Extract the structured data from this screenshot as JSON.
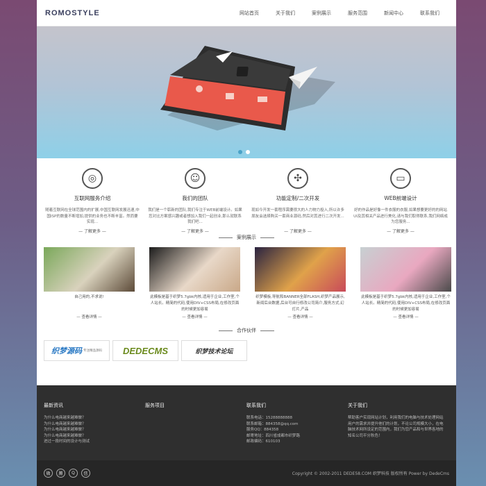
{
  "header": {
    "logo": "ROMOSTYLE",
    "nav": [
      "网站首页",
      "关于我们",
      "案例展示",
      "服务范围",
      "新闻中心",
      "联系我们"
    ]
  },
  "banner": {
    "dots": [
      {
        "active": true,
        "color": "#4aa3c8"
      },
      {
        "active": false,
        "color": "#ffffff"
      }
    ],
    "colors": {
      "screen": "#e9594b",
      "frame": "#2d2d2d"
    }
  },
  "services": [
    {
      "icon": "globe-icon",
      "glyph": "◎",
      "title": "互联网服务介绍",
      "desc": "随着互联网在全球范围内的扩展,中国互联网发展迅速,中国ISP的数量不断增加,提供的业务也不断丰富。然而要实现...",
      "more": "— 了解更多 —"
    },
    {
      "icon": "team-icon",
      "glyph": "☺",
      "title": "我们的团队",
      "desc": "我们是一个崭新的团队,我们专注于WEB前端设计。如果您对比方案感兴趣或者想加入我们一起创业,那么就联系我们吧...",
      "more": "— 了解更多 —"
    },
    {
      "icon": "custom-dev-icon",
      "glyph": "✣",
      "title": "功能定制/二次开发",
      "desc": "现如今开发一套程序需要很大的人力物力投入,所以许多朋友会选择购买一套商业源码,然后对其进行二次开发...",
      "more": "— 了解更多 —"
    },
    {
      "icon": "web-frontend-icon",
      "glyph": "▭",
      "title": "WEB前端设计",
      "desc": "好的作品是好像一件衣服的衣服,如果想要更好的的网站UI及其相关产品进行美化,请与我们取得联系,我们网络成为您服务...",
      "more": "— 了解更多 —"
    }
  ],
  "cases_heading": "案例展示",
  "cases": [
    {
      "desc": "自己用的,不求说!",
      "more": "— 查看详情 —",
      "colors": [
        "#7aa85a",
        "#d9d2bd",
        "#5c4a38"
      ]
    },
    {
      "desc": "此模板是基于织梦5.7gbk内核,适用于企业,工作室,个人站长。精简的代码,使用DIV+CSS布局,在修改页面的时候更加容易",
      "more": "— 查看详情 —",
      "colors": [
        "#1c1c1c",
        "#e8d8c8",
        "#c9a888"
      ]
    },
    {
      "desc": "织梦模板,导航和BANNER全部FLASH,织梦产品展示,新闻后台数据,后台可自行修改公司简介,服务方式,幻灯片,产品",
      "more": "— 查看详情 —",
      "colors": [
        "#2a2340",
        "#e0a24a",
        "#c84a5a"
      ]
    },
    {
      "desc": "此模板是基于织梦5.7gbk内核,适用于企业,工作室,个人站长。精简的代码,使用DIV+CSS布局,在修改页面的时候更加容易",
      "more": "— 查看详情 —",
      "colors": [
        "#c7d0d2",
        "#e9a8c0",
        "#4a4a4a"
      ]
    }
  ],
  "partners_heading": "合作伙伴",
  "partners": [
    {
      "name": "织梦源码",
      "sub": "专注精品源码",
      "color": "#2a79c4"
    },
    {
      "name": "DEDECMS",
      "sub": "",
      "color": "#6a8a1c"
    },
    {
      "name": "织梦技术论坛",
      "sub": "",
      "color": "#333333"
    }
  ],
  "footer": {
    "columns": [
      {
        "title": "最新资讯",
        "lines": [
          "为什么电商越来越难做？",
          "为什么电商越来越难做？",
          "为什么电商越来越难做？",
          "为什么电商越来越难做？",
          "进过一段时间的设计与测试"
        ]
      },
      {
        "title": "服务项目",
        "lines": []
      },
      {
        "title": "联系我们",
        "lines": [
          "联系电话：15288888888",
          "联系邮箱：884358@qq.com",
          "服务QQ：884358",
          "邮寄地址：四川省成都市织梦路",
          "邮政编码：610103"
        ]
      },
      {
        "title": "关于我们",
        "lines": [
          "帮助客户实现网站计划，利用我们的电脑与技术处理网站用户的需求并提升他们的计划，不论公司规模大小，在电脑技术网所设定的范围内，我们为您产品和与世界各地的知名公司平分秋色！"
        ]
      }
    ],
    "social": [
      "weibo-icon",
      "tencent-weibo-icon",
      "qq-icon",
      "wechat-icon"
    ],
    "copyright": "Copyright © 2002-2011 DEDE58.COM 织梦科技 版权所有 Power by DedeCms"
  }
}
